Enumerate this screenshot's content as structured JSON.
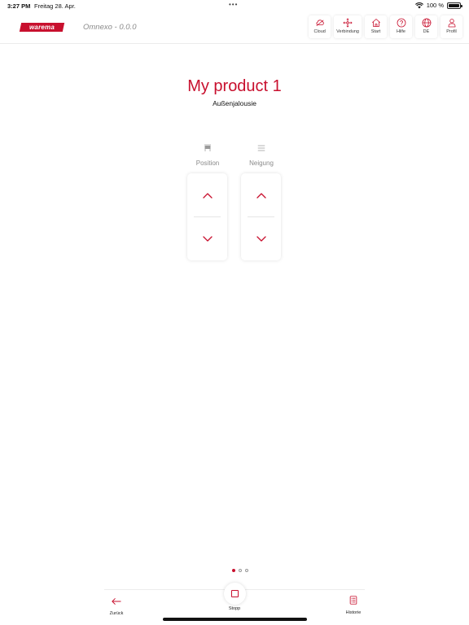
{
  "statusbar": {
    "time": "3:27 PM",
    "date": "Freitag 28. Apr.",
    "battery": "100 %",
    "battery_level": 1.0
  },
  "header": {
    "logo_text": "warema",
    "app_title": "Omnexo - 0.0.0",
    "nav": [
      {
        "label": "Cloud",
        "icon": "cloud-off-icon"
      },
      {
        "label": "Verbindung",
        "icon": "connection-icon"
      },
      {
        "label": "Start",
        "icon": "home-icon"
      },
      {
        "label": "Hilfe",
        "icon": "help-icon"
      },
      {
        "label": "DE",
        "icon": "globe-icon"
      },
      {
        "label": "Profil",
        "icon": "user-icon"
      }
    ]
  },
  "product": {
    "name": "My product 1",
    "type": "Außenjalousie"
  },
  "controls": [
    {
      "label": "Position",
      "icon": "blind-position-icon"
    },
    {
      "label": "Neigung",
      "icon": "slat-tilt-icon"
    }
  ],
  "pagination": {
    "count": 3,
    "active": 1
  },
  "bottombar": {
    "back_label": "Zurück",
    "stop_label": "Stopp",
    "history_label": "Historie"
  },
  "colors": {
    "accent": "#c8102e",
    "muted_text": "#8a8a8a"
  }
}
